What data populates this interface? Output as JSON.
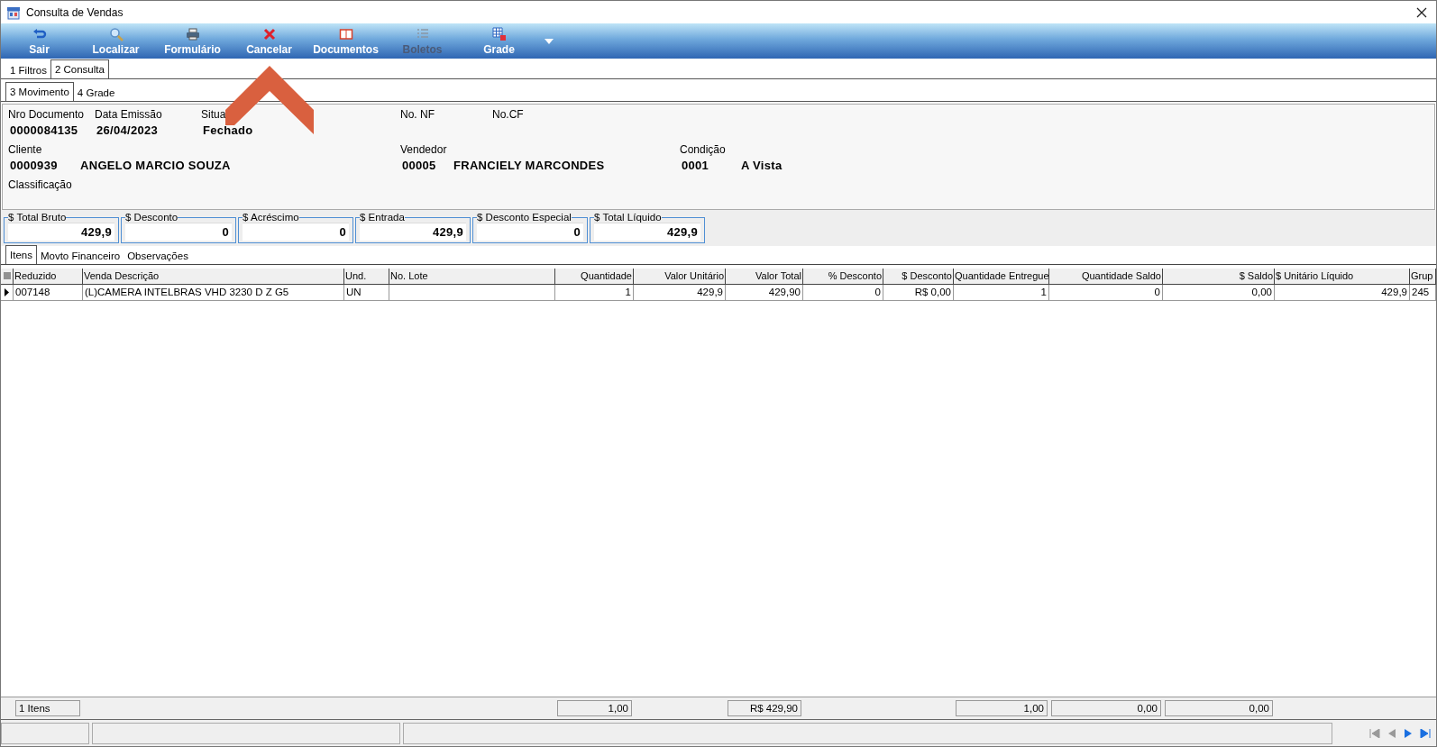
{
  "window": {
    "title": "Consulta de Vendas"
  },
  "toolbar": [
    {
      "label": "Sair",
      "kind": "undo",
      "disabled": false
    },
    {
      "label": "Localizar",
      "kind": "search",
      "disabled": false
    },
    {
      "label": "Formulário",
      "kind": "print",
      "disabled": false
    },
    {
      "label": "Cancelar",
      "kind": "cancel",
      "disabled": false
    },
    {
      "label": "Documentos",
      "kind": "book",
      "disabled": false
    },
    {
      "label": "Boletos",
      "kind": "list",
      "disabled": true
    },
    {
      "label": "Grade",
      "kind": "grid",
      "disabled": false
    }
  ],
  "tabs": [
    {
      "label": "1 Filtros",
      "selected": false
    },
    {
      "label": "2 Consulta",
      "selected": true
    }
  ],
  "subtabs": [
    {
      "label": "3 Movimento",
      "selected": true
    },
    {
      "label": "4 Grade",
      "selected": false
    }
  ],
  "movement": {
    "nro_documento": {
      "label": "Nro Documento",
      "value": "0000084135"
    },
    "data_emissao": {
      "label": "Data Emissão",
      "value": "26/04/2023"
    },
    "situacao": {
      "label": "Situa",
      "value": "Fechado"
    },
    "no_nf": {
      "label": "No. NF"
    },
    "no_cf": {
      "label": "No.CF"
    },
    "cliente": {
      "label": "Cliente",
      "code": "0000939",
      "name": "ANGELO MARCIO SOUZA"
    },
    "vendedor": {
      "label": "Vendedor",
      "code": "00005",
      "name": "FRANCIELY MARCONDES"
    },
    "condicao": {
      "label": "Condição",
      "code": "0001",
      "name": "A Vista"
    },
    "classificacao": {
      "label": "Classificação"
    }
  },
  "totals": [
    {
      "label": "$ Total Bruto",
      "value": "429,9"
    },
    {
      "label": "$ Desconto",
      "value": "0"
    },
    {
      "label": "$ Acréscimo",
      "value": "0"
    },
    {
      "label": "$ Entrada",
      "value": "429,9"
    },
    {
      "label": "$ Desconto Especial",
      "value": "0"
    },
    {
      "label": "$ Total Líquido",
      "value": "429,9"
    }
  ],
  "detail_tabs": [
    {
      "label": "Itens",
      "selected": true
    },
    {
      "label": "Movto Financeiro",
      "selected": false
    },
    {
      "label": "Observações",
      "selected": false
    }
  ],
  "items_table": {
    "columns": [
      "Reduzido",
      "Venda Descrição",
      "Und.",
      "No. Lote",
      "Quantidade",
      "Valor Unitário",
      "Valor Total",
      "% Desconto",
      "$ Desconto",
      "Quantidade Entregue",
      "Quantidade Saldo",
      "$ Saldo",
      "$ Unitário Líquido",
      "Grup"
    ],
    "rows": [
      {
        "selected": true,
        "cells": [
          "007148",
          "(L)CAMERA INTELBRAS VHD 3230 D Z G5",
          "UN",
          null,
          "1",
          "429,9",
          "429,90",
          "0",
          "R$ 0,00",
          "1",
          "0",
          "0,00",
          "429,9",
          "245"
        ]
      }
    ]
  },
  "footer": {
    "count": "1 Itens",
    "totals": [
      "1,00",
      "R$ 429,90",
      "1,00",
      "0,00",
      "0,00"
    ]
  }
}
